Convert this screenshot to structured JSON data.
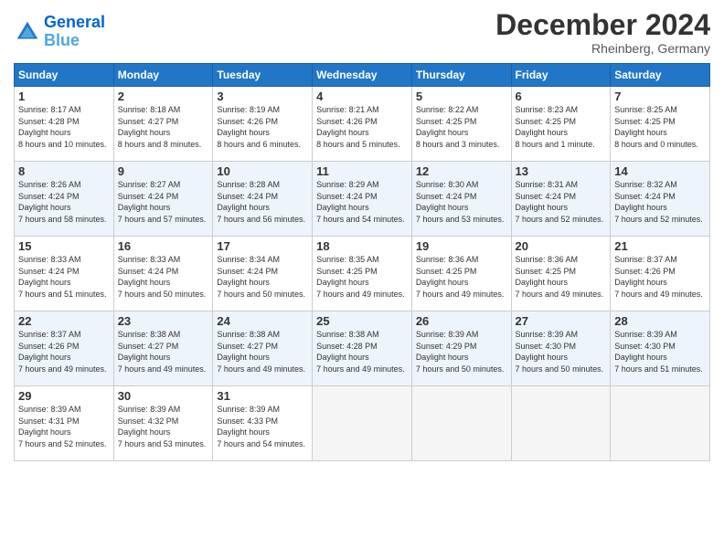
{
  "header": {
    "logo_line1": "General",
    "logo_line2": "Blue",
    "month": "December 2024",
    "location": "Rheinberg, Germany"
  },
  "columns": [
    "Sunday",
    "Monday",
    "Tuesday",
    "Wednesday",
    "Thursday",
    "Friday",
    "Saturday"
  ],
  "weeks": [
    [
      {
        "day": "1",
        "sunrise": "8:17 AM",
        "sunset": "4:28 PM",
        "daylight": "8 hours and 10 minutes."
      },
      {
        "day": "2",
        "sunrise": "8:18 AM",
        "sunset": "4:27 PM",
        "daylight": "8 hours and 8 minutes."
      },
      {
        "day": "3",
        "sunrise": "8:19 AM",
        "sunset": "4:26 PM",
        "daylight": "8 hours and 6 minutes."
      },
      {
        "day": "4",
        "sunrise": "8:21 AM",
        "sunset": "4:26 PM",
        "daylight": "8 hours and 5 minutes."
      },
      {
        "day": "5",
        "sunrise": "8:22 AM",
        "sunset": "4:25 PM",
        "daylight": "8 hours and 3 minutes."
      },
      {
        "day": "6",
        "sunrise": "8:23 AM",
        "sunset": "4:25 PM",
        "daylight": "8 hours and 1 minute."
      },
      {
        "day": "7",
        "sunrise": "8:25 AM",
        "sunset": "4:25 PM",
        "daylight": "8 hours and 0 minutes."
      }
    ],
    [
      {
        "day": "8",
        "sunrise": "8:26 AM",
        "sunset": "4:24 PM",
        "daylight": "7 hours and 58 minutes."
      },
      {
        "day": "9",
        "sunrise": "8:27 AM",
        "sunset": "4:24 PM",
        "daylight": "7 hours and 57 minutes."
      },
      {
        "day": "10",
        "sunrise": "8:28 AM",
        "sunset": "4:24 PM",
        "daylight": "7 hours and 56 minutes."
      },
      {
        "day": "11",
        "sunrise": "8:29 AM",
        "sunset": "4:24 PM",
        "daylight": "7 hours and 54 minutes."
      },
      {
        "day": "12",
        "sunrise": "8:30 AM",
        "sunset": "4:24 PM",
        "daylight": "7 hours and 53 minutes."
      },
      {
        "day": "13",
        "sunrise": "8:31 AM",
        "sunset": "4:24 PM",
        "daylight": "7 hours and 52 minutes."
      },
      {
        "day": "14",
        "sunrise": "8:32 AM",
        "sunset": "4:24 PM",
        "daylight": "7 hours and 52 minutes."
      }
    ],
    [
      {
        "day": "15",
        "sunrise": "8:33 AM",
        "sunset": "4:24 PM",
        "daylight": "7 hours and 51 minutes."
      },
      {
        "day": "16",
        "sunrise": "8:33 AM",
        "sunset": "4:24 PM",
        "daylight": "7 hours and 50 minutes."
      },
      {
        "day": "17",
        "sunrise": "8:34 AM",
        "sunset": "4:24 PM",
        "daylight": "7 hours and 50 minutes."
      },
      {
        "day": "18",
        "sunrise": "8:35 AM",
        "sunset": "4:25 PM",
        "daylight": "7 hours and 49 minutes."
      },
      {
        "day": "19",
        "sunrise": "8:36 AM",
        "sunset": "4:25 PM",
        "daylight": "7 hours and 49 minutes."
      },
      {
        "day": "20",
        "sunrise": "8:36 AM",
        "sunset": "4:25 PM",
        "daylight": "7 hours and 49 minutes."
      },
      {
        "day": "21",
        "sunrise": "8:37 AM",
        "sunset": "4:26 PM",
        "daylight": "7 hours and 49 minutes."
      }
    ],
    [
      {
        "day": "22",
        "sunrise": "8:37 AM",
        "sunset": "4:26 PM",
        "daylight": "7 hours and 49 minutes."
      },
      {
        "day": "23",
        "sunrise": "8:38 AM",
        "sunset": "4:27 PM",
        "daylight": "7 hours and 49 minutes."
      },
      {
        "day": "24",
        "sunrise": "8:38 AM",
        "sunset": "4:27 PM",
        "daylight": "7 hours and 49 minutes."
      },
      {
        "day": "25",
        "sunrise": "8:38 AM",
        "sunset": "4:28 PM",
        "daylight": "7 hours and 49 minutes."
      },
      {
        "day": "26",
        "sunrise": "8:39 AM",
        "sunset": "4:29 PM",
        "daylight": "7 hours and 50 minutes."
      },
      {
        "day": "27",
        "sunrise": "8:39 AM",
        "sunset": "4:30 PM",
        "daylight": "7 hours and 50 minutes."
      },
      {
        "day": "28",
        "sunrise": "8:39 AM",
        "sunset": "4:30 PM",
        "daylight": "7 hours and 51 minutes."
      }
    ],
    [
      {
        "day": "29",
        "sunrise": "8:39 AM",
        "sunset": "4:31 PM",
        "daylight": "7 hours and 52 minutes."
      },
      {
        "day": "30",
        "sunrise": "8:39 AM",
        "sunset": "4:32 PM",
        "daylight": "7 hours and 53 minutes."
      },
      {
        "day": "31",
        "sunrise": "8:39 AM",
        "sunset": "4:33 PM",
        "daylight": "7 hours and 54 minutes."
      },
      null,
      null,
      null,
      null
    ]
  ]
}
